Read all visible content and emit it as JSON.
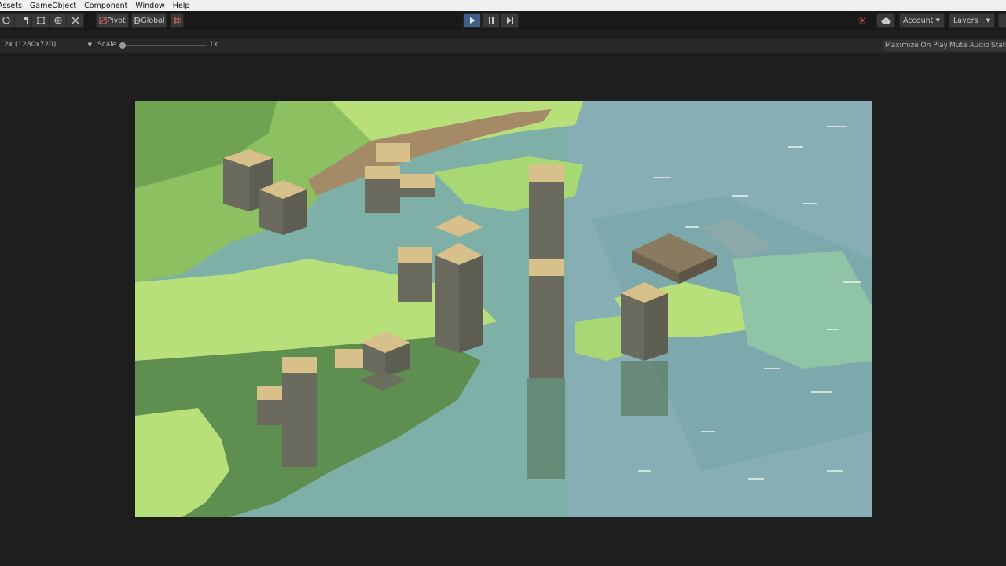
{
  "menu": [
    "Assets",
    "GameObject",
    "Component",
    "Window",
    "Help"
  ],
  "toolbar": {
    "pivot_label": "Pivot",
    "global_label": "Global",
    "account_label": "Account",
    "layers_label": "Layers",
    "tools": [
      "rotate-tool-icon",
      "scale-tool-icon",
      "rect-tool-icon",
      "transform-tool-icon",
      "custom-tool-icon"
    ]
  },
  "playmode": {
    "play_active": true
  },
  "game_view": {
    "resolution": "2x (1280x720)",
    "scale_label": "Scale",
    "scale_value": "1x",
    "scale_fraction": 0.0,
    "maximize_label": "Maximize On Play",
    "mute_label": "Mute Audio",
    "stats_label": "Stats"
  },
  "colors": {
    "accent": "#3d5f88",
    "grass_light": "#b8e07a",
    "grass_mid": "#8dc060",
    "grass_dark": "#5e8e50",
    "water": "#7fb0a8",
    "pillar_side": "#6b6a5e",
    "pillar_top": "#d8c08a"
  }
}
